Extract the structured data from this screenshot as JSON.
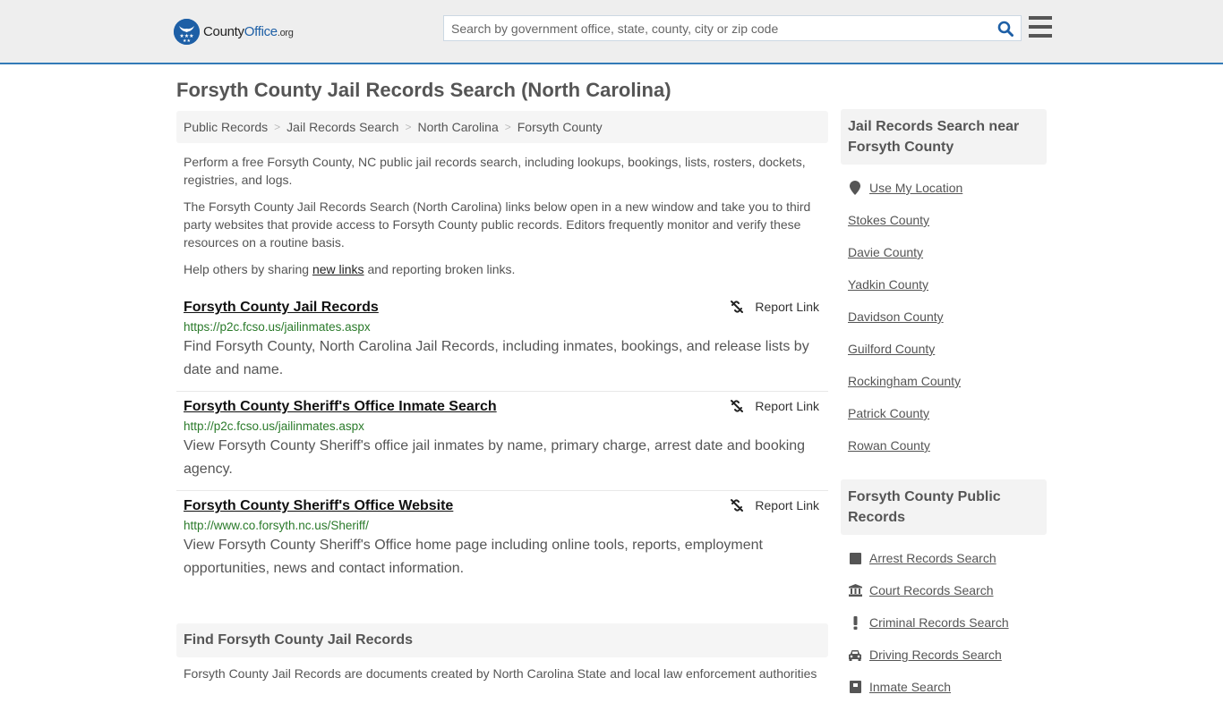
{
  "header": {
    "logo": {
      "name_part1": "County",
      "name_part2": "Office",
      "suffix": ".org"
    },
    "search": {
      "placeholder": "Search by government office, state, county, city or zip code",
      "value": ""
    },
    "icons": {
      "search": "search-icon",
      "menu": "hamburger-menu-icon"
    }
  },
  "page": {
    "title": "Forsyth County Jail Records Search (North Carolina)"
  },
  "breadcrumb": [
    {
      "label": "Public Records"
    },
    {
      "label": "Jail Records Search"
    },
    {
      "label": "North Carolina"
    },
    {
      "label": "Forsyth County"
    }
  ],
  "breadcrumb_separator": ">",
  "intro": {
    "p1": "Perform a free Forsyth County, NC public jail records search, including lookups, bookings, lists, rosters, dockets, registries, and logs.",
    "p2": "The Forsyth County Jail Records Search (North Carolina) links below open in a new window and take you to third party websites that provide access to Forsyth County public records. Editors frequently monitor and verify these resources on a routine basis.",
    "p3_before": "Help others by sharing ",
    "p3_link": "new links",
    "p3_after": " and reporting broken links."
  },
  "links": [
    {
      "title": "Forsyth County Jail Records",
      "url": "https://p2c.fcso.us/jailinmates.aspx",
      "description": "Find Forsyth County, North Carolina Jail Records, including inmates, bookings, and release lists by date and name.",
      "report_label": "Report Link"
    },
    {
      "title": "Forsyth County Sheriff's Office Inmate Search",
      "url": "http://p2c.fcso.us/jailinmates.aspx",
      "description": "View Forsyth County Sheriff's office jail inmates by name, primary charge, arrest date and booking agency.",
      "report_label": "Report Link"
    },
    {
      "title": "Forsyth County Sheriff's Office Website",
      "url": "http://www.co.forsyth.nc.us/Sheriff/",
      "description": "View Forsyth County Sheriff's Office home page including online tools, reports, employment opportunities, news and contact information.",
      "report_label": "Report Link"
    }
  ],
  "find_section": {
    "title": "Find Forsyth County Jail Records",
    "text": "Forsyth County Jail Records are documents created by North Carolina State and local law enforcement authorities"
  },
  "sidebar": {
    "nearby": {
      "title": "Jail Records Search near Forsyth County",
      "use_location": "Use My Location",
      "counties": [
        "Stokes County",
        "Davie County",
        "Yadkin County",
        "Davidson County",
        "Guilford County",
        "Rockingham County",
        "Patrick County",
        "Rowan County"
      ]
    },
    "public_records": {
      "title": "Forsyth County Public Records",
      "items": [
        {
          "label": "Arrest Records Search",
          "icon": "square-icon"
        },
        {
          "label": "Court Records Search",
          "icon": "courthouse-icon"
        },
        {
          "label": "Criminal Records Search",
          "icon": "exclamation-icon"
        },
        {
          "label": "Driving Records Search",
          "icon": "car-icon"
        },
        {
          "label": "Inmate Search",
          "icon": "jail-icon"
        }
      ]
    }
  },
  "colors": {
    "accent_blue": "#337ab7",
    "logo_blue": "#1d5fa6",
    "url_green": "#2a7a2a",
    "header_bg": "#eeeeee"
  }
}
